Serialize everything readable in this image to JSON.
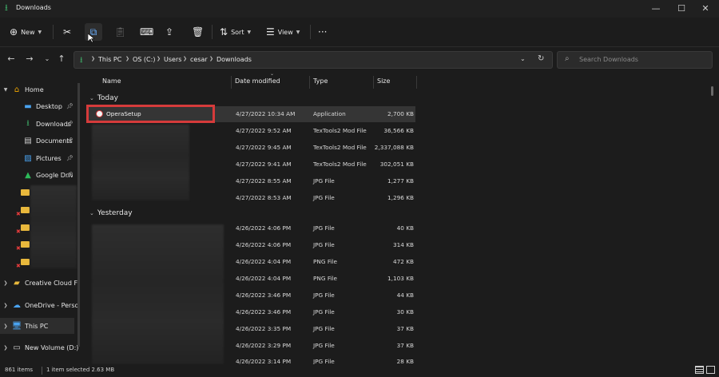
{
  "window": {
    "title": "Downloads",
    "minimize": "—",
    "maximize": "☐",
    "close": "✕"
  },
  "toolbar": {
    "new_label": "New",
    "sort_label": "Sort",
    "view_label": "View",
    "more": "···"
  },
  "address": {
    "crumbs": [
      "This PC",
      "OS (C:)",
      "Users",
      "cesar",
      "Downloads"
    ],
    "search_placeholder": "Search Downloads"
  },
  "nav": {
    "home": "Home",
    "desktop": "Desktop",
    "downloads": "Downloads",
    "documents": "Documents",
    "pictures": "Pictures",
    "google_drive": "Google Drive",
    "creative_cloud": "Creative Cloud F",
    "onedrive": "OneDrive - Perso",
    "this_pc": "This PC",
    "new_volume": "New Volume (D:)"
  },
  "columns": {
    "name": "Name",
    "date": "Date modified",
    "type": "Type",
    "size": "Size"
  },
  "groups": {
    "today": "Today",
    "yesterday": "Yesterday"
  },
  "today_rows": [
    {
      "name": "OperaSetup",
      "date": "4/27/2022 10:34 AM",
      "type": "Application",
      "size": "2,700 KB"
    },
    {
      "name": "",
      "date": "4/27/2022 9:52 AM",
      "type": "TexTools2 Mod File",
      "size": "36,566 KB"
    },
    {
      "name": "",
      "date": "4/27/2022 9:45 AM",
      "type": "TexTools2 Mod File",
      "size": "2,337,088 KB"
    },
    {
      "name": "",
      "date": "4/27/2022 9:41 AM",
      "type": "TexTools2 Mod File",
      "size": "302,051 KB"
    },
    {
      "name": "",
      "date": "4/27/2022 8:55 AM",
      "type": "JPG File",
      "size": "1,277 KB"
    },
    {
      "name": "",
      "date": "4/27/2022 8:53 AM",
      "type": "JPG File",
      "size": "1,296 KB"
    }
  ],
  "yesterday_rows": [
    {
      "date": "4/26/2022 4:06 PM",
      "type": "JPG File",
      "size": "40 KB"
    },
    {
      "date": "4/26/2022 4:06 PM",
      "type": "JPG File",
      "size": "314 KB"
    },
    {
      "date": "4/26/2022 4:04 PM",
      "type": "PNG File",
      "size": "472 KB"
    },
    {
      "date": "4/26/2022 4:04 PM",
      "type": "PNG File",
      "size": "1,103 KB"
    },
    {
      "date": "4/26/2022 3:46 PM",
      "type": "JPG File",
      "size": "44 KB"
    },
    {
      "date": "4/26/2022 3:46 PM",
      "type": "JPG File",
      "size": "30 KB"
    },
    {
      "date": "4/26/2022 3:35 PM",
      "type": "JPG File",
      "size": "37 KB"
    },
    {
      "date": "4/26/2022 3:29 PM",
      "type": "JPG File",
      "size": "37 KB"
    },
    {
      "date": "4/26/2022 3:14 PM",
      "type": "JPG File",
      "size": "28 KB"
    }
  ],
  "status": {
    "items": "861 items",
    "selected": "1 item selected  2.63 MB"
  },
  "colors": {
    "accent": "#3fb36a",
    "highlight": "#d63b3b",
    "folder": "#e8b83c",
    "selection": "#353535"
  }
}
